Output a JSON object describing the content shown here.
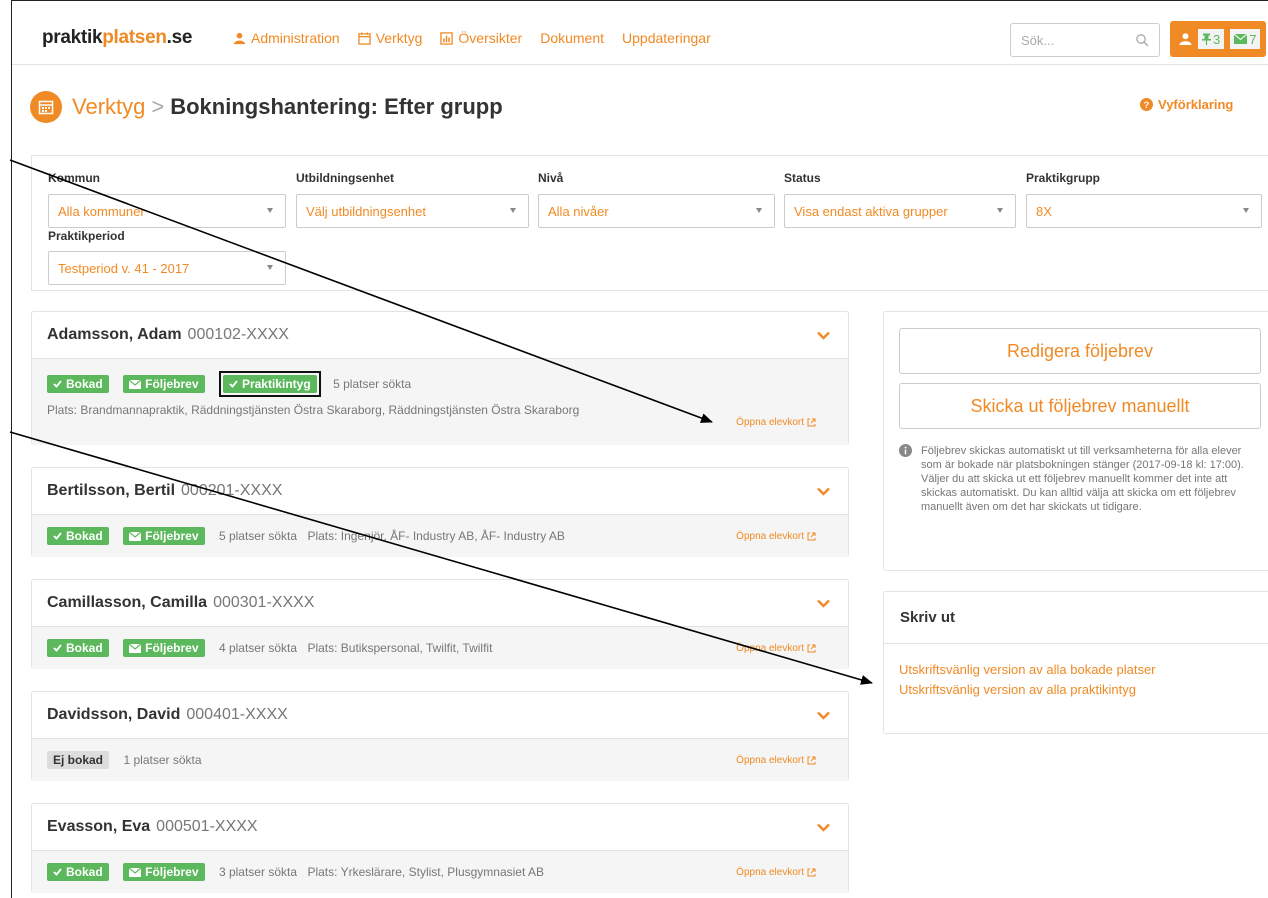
{
  "logo": {
    "part1": "praktik",
    "part2": "platsen",
    "part3": ".se"
  },
  "nav": [
    {
      "label": "Administration",
      "icon": "user-icon"
    },
    {
      "label": "Verktyg",
      "icon": "calendar-icon"
    },
    {
      "label": "Översikter",
      "icon": "chart-icon"
    },
    {
      "label": "Dokument",
      "icon": ""
    },
    {
      "label": "Uppdateringar",
      "icon": ""
    }
  ],
  "search": {
    "placeholder": "Sök..."
  },
  "user": {
    "pin_count": "3",
    "mail_count": "7"
  },
  "page": {
    "crumb": "Verktyg",
    "separator": ">",
    "title": "Bokningshantering: Efter grupp",
    "help": "Vyförklaring"
  },
  "filters": {
    "kommun": {
      "label": "Kommun",
      "value": "Alla kommuner"
    },
    "utbildningsenhet": {
      "label": "Utbildningsenhet",
      "value": "Välj utbildningsenhet"
    },
    "niva": {
      "label": "Nivå",
      "value": "Alla nivåer"
    },
    "status": {
      "label": "Status",
      "value": "Visa endast aktiva grupper"
    },
    "praktikgrupp": {
      "label": "Praktikgrupp",
      "value": "8X"
    },
    "praktikperiod": {
      "label": "Praktikperiod",
      "value": "Testperiod v. 41 - 2017"
    }
  },
  "students": [
    {
      "name": "Adamsson, Adam",
      "pnr": "000102-XXXX",
      "tags": [
        "Bokad",
        "Följebrev",
        "Praktikintyg"
      ],
      "searched": "5 platser sökta",
      "place": "Plats: Brandmannapraktik, Räddningstjänsten Östra Skaraborg, Räddningstjänsten Östra Skaraborg",
      "open": "Öppna elevkort"
    },
    {
      "name": "Bertilsson, Bertil",
      "pnr": "000201-XXXX",
      "tags": [
        "Bokad",
        "Följebrev"
      ],
      "searched": "5 platser sökta",
      "place": "Plats: Ingenjör, ÅF- Industry AB, ÅF- Industry AB",
      "open": "Öppna elevkort"
    },
    {
      "name": "Camillasson, Camilla",
      "pnr": "000301-XXXX",
      "tags": [
        "Bokad",
        "Följebrev"
      ],
      "searched": "4 platser sökta",
      "place": "Plats: Butikspersonal, Twilfit, Twilfit",
      "open": "Öppna elevkort"
    },
    {
      "name": "Davidsson, David",
      "pnr": "000401-XXXX",
      "tags": [
        "Ej bokad"
      ],
      "searched": "1 platser sökta",
      "place": "",
      "open": "Öppna elevkort"
    },
    {
      "name": "Evasson, Eva",
      "pnr": "000501-XXXX",
      "tags": [
        "Bokad",
        "Följebrev"
      ],
      "searched": "3 platser sökta",
      "place": "Plats: Yrkeslärare, Stylist, Plusgymnasiet AB",
      "open": "Öppna elevkort"
    }
  ],
  "actions": {
    "edit_letter": "Redigera följebrev",
    "send_letter": "Skicka ut följebrev manuellt",
    "info": "Följebrev skickas automatiskt ut till verksamheterna för alla elever som är bokade när platsbokningen stänger (2017-09-18 kl: 17:00). Väljer du att skicka ut ett följebrev manuellt kommer det inte att skickas automatiskt. Du kan alltid välja att skicka om ett följebrev manuellt även om det har skickats ut tidigare."
  },
  "print": {
    "title": "Skriv ut",
    "link1": "Utskriftsvänlig version av alla bokade platser",
    "link2": "Utskriftsvänlig version av alla praktikintyg"
  },
  "colors": {
    "accent": "#f08a24",
    "success": "#5cb85c",
    "muted": "#777777"
  }
}
